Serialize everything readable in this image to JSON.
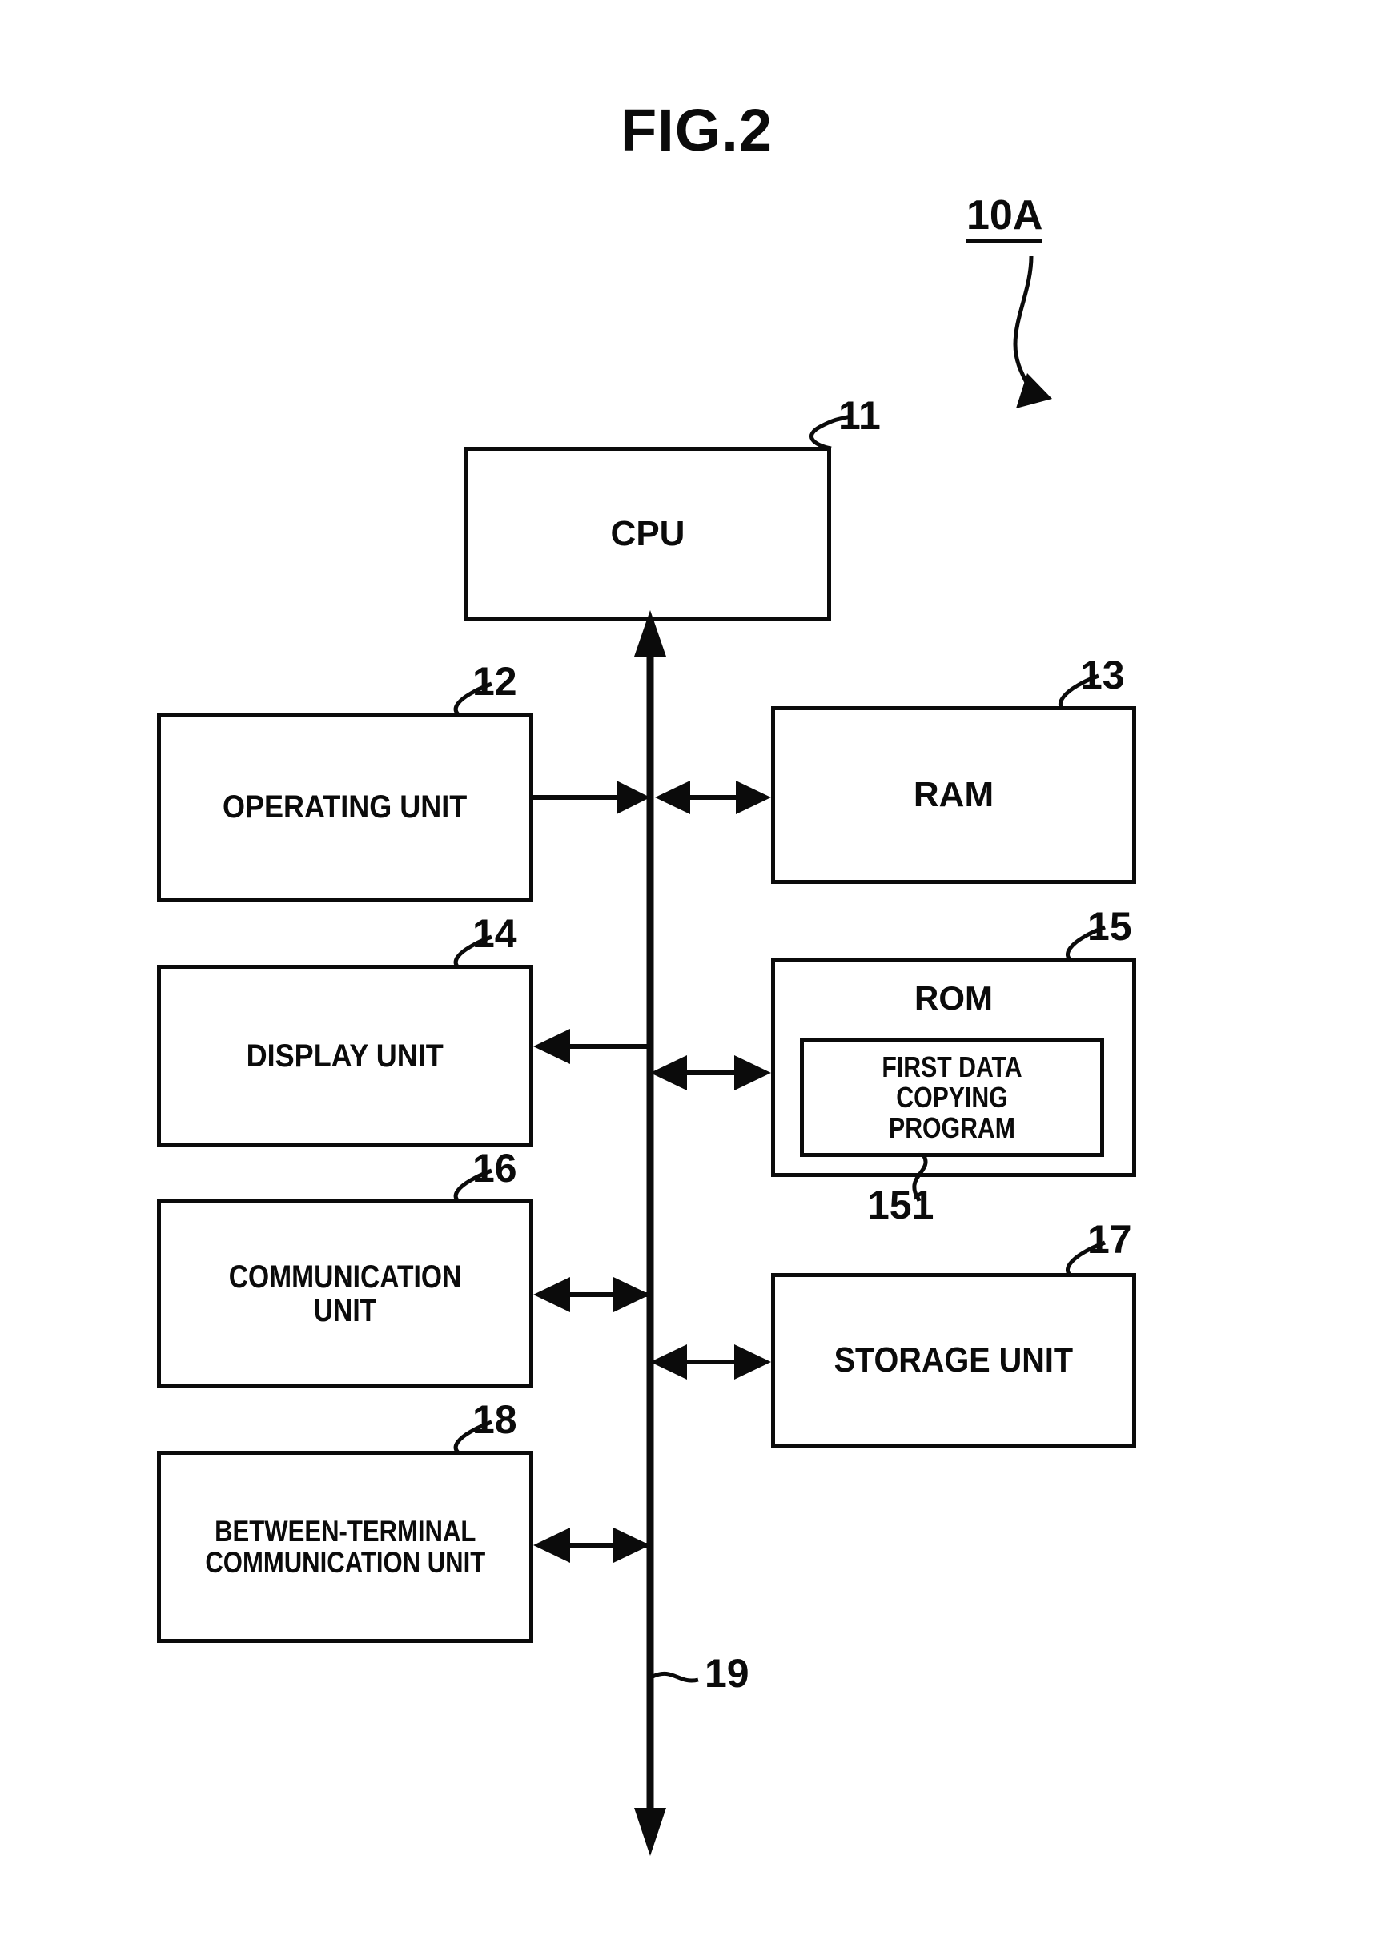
{
  "figure": {
    "title": "FIG.2",
    "system_ref": "10A"
  },
  "blocks": [
    {
      "id": "cpu",
      "label": "CPU",
      "ref": "11"
    },
    {
      "id": "operating",
      "label": "OPERATING UNIT",
      "ref": "12"
    },
    {
      "id": "ram",
      "label": "RAM",
      "ref": "13"
    },
    {
      "id": "display",
      "label": "DISPLAY UNIT",
      "ref": "14"
    },
    {
      "id": "rom",
      "label": "ROM",
      "ref": "15"
    },
    {
      "id": "program",
      "label": "FIRST DATA\nCOPYING PROGRAM",
      "ref": "151"
    },
    {
      "id": "comm",
      "label": "COMMUNICATION UNIT",
      "ref": "16"
    },
    {
      "id": "storage",
      "label": "STORAGE UNIT",
      "ref": "17"
    },
    {
      "id": "between",
      "label": "BETWEEN-TERMINAL\nCOMMUNICATION UNIT",
      "ref": "18"
    },
    {
      "id": "bus",
      "label": "",
      "ref": "19"
    }
  ],
  "refs": {
    "cpu": "11",
    "operating": "12",
    "ram": "13",
    "display": "14",
    "rom": "15",
    "program": "151",
    "comm": "16",
    "storage": "17",
    "between": "18",
    "bus": "19"
  },
  "labels": {
    "cpu": "CPU",
    "operating": "OPERATING UNIT",
    "ram": "RAM",
    "display": "DISPLAY UNIT",
    "rom": "ROM",
    "program": "FIRST DATA\nCOPYING PROGRAM",
    "comm": "COMMUNICATION UNIT",
    "storage": "STORAGE UNIT",
    "between": "BETWEEN-TERMINAL\nCOMMUNICATION UNIT"
  },
  "connections": [
    {
      "from": "bus",
      "to": "cpu",
      "direction": "one-way-up"
    },
    {
      "from": "operating",
      "to": "bus",
      "direction": "one-way-right"
    },
    {
      "from": "bus",
      "to": "ram",
      "direction": "two-way"
    },
    {
      "from": "bus",
      "to": "display",
      "direction": "one-way-left"
    },
    {
      "from": "bus",
      "to": "rom",
      "direction": "two-way"
    },
    {
      "from": "comm",
      "to": "bus",
      "direction": "two-way"
    },
    {
      "from": "bus",
      "to": "storage",
      "direction": "two-way"
    },
    {
      "from": "between",
      "to": "bus",
      "direction": "two-way"
    }
  ],
  "colors": {
    "ink": "#0b0b0b",
    "paper": "#ffffff"
  }
}
